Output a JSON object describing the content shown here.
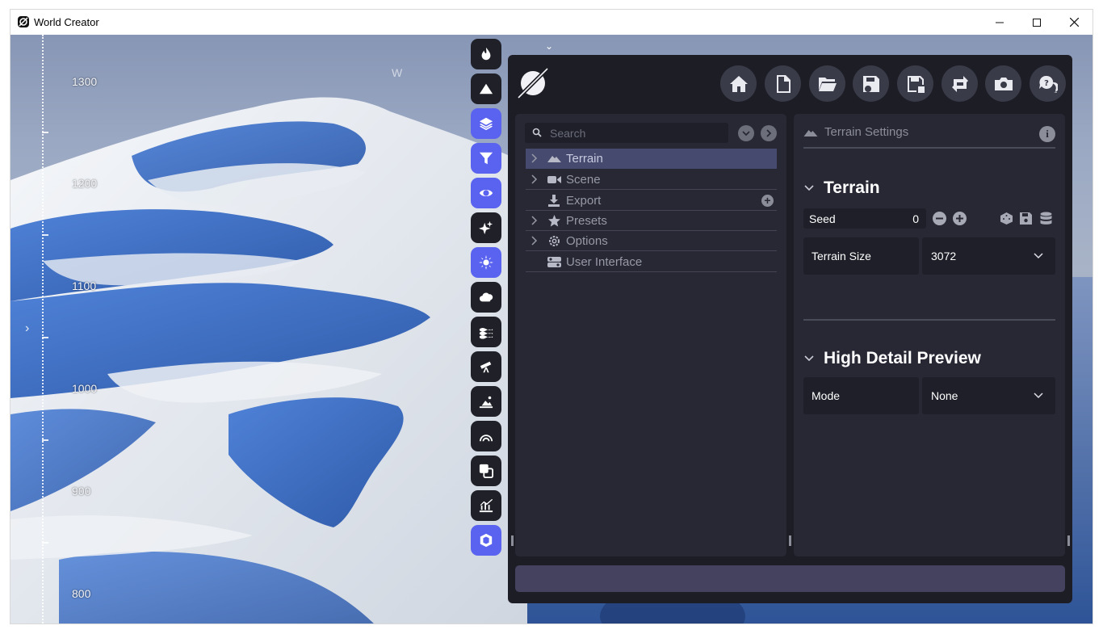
{
  "window": {
    "title": "World Creator",
    "controls": [
      "minimize",
      "maximize",
      "close"
    ]
  },
  "viewport": {
    "ruler_labels": [
      "1300",
      "1200",
      "1100",
      "1000",
      "900",
      "800"
    ],
    "compass_label": "W",
    "colors": {
      "snow": "#eef1f5",
      "ice": "#3f6fc3",
      "sky": "#9aa8c3"
    }
  },
  "toolbar": {
    "items": [
      {
        "name": "fire-icon",
        "active": false
      },
      {
        "name": "mountain-icon",
        "active": false
      },
      {
        "name": "layers-icon",
        "active": true
      },
      {
        "name": "filter-icon",
        "active": true
      },
      {
        "name": "eye-icon",
        "active": true
      },
      {
        "name": "sparkles-icon",
        "active": false
      },
      {
        "name": "sun-icon",
        "active": true
      },
      {
        "name": "cloud-icon",
        "active": false
      },
      {
        "name": "water-icon",
        "active": false
      },
      {
        "name": "telescope-icon",
        "active": false
      },
      {
        "name": "island-icon",
        "active": false
      },
      {
        "name": "rainbow-icon",
        "active": false
      },
      {
        "name": "copy-icon",
        "active": false
      },
      {
        "name": "chart-icon",
        "active": false
      },
      {
        "name": "box-icon",
        "active": true
      }
    ],
    "accent": "#5a63ef"
  },
  "header": {
    "buttons": [
      "home-icon",
      "new-file-icon",
      "open-folder-icon",
      "save-icon",
      "save-as-icon",
      "sync-icon",
      "camera-icon",
      "help-icon"
    ]
  },
  "tree": {
    "search_placeholder": "Search",
    "items": [
      {
        "label": "Terrain",
        "icon": "terrain-icon",
        "expandable": true,
        "selected": true
      },
      {
        "label": "Scene",
        "icon": "video-camera-icon",
        "expandable": true,
        "selected": false
      },
      {
        "label": "Export",
        "icon": "download-icon",
        "expandable": false,
        "selected": false,
        "has_add": true
      },
      {
        "label": "Presets",
        "icon": "star-icon",
        "expandable": true,
        "selected": false
      },
      {
        "label": "Options",
        "icon": "gear-icon",
        "expandable": true,
        "selected": false
      },
      {
        "label": "User Interface",
        "icon": "toggles-icon",
        "expandable": false,
        "selected": false
      }
    ]
  },
  "settings": {
    "header_title": "Terrain Settings",
    "terrain_section": {
      "title": "Terrain",
      "seed_label": "Seed",
      "seed_value": "0",
      "terrain_size_label": "Terrain Size",
      "terrain_size_value": "3072"
    },
    "preview_section": {
      "title": "High Detail Preview",
      "mode_label": "Mode",
      "mode_value": "None"
    }
  }
}
